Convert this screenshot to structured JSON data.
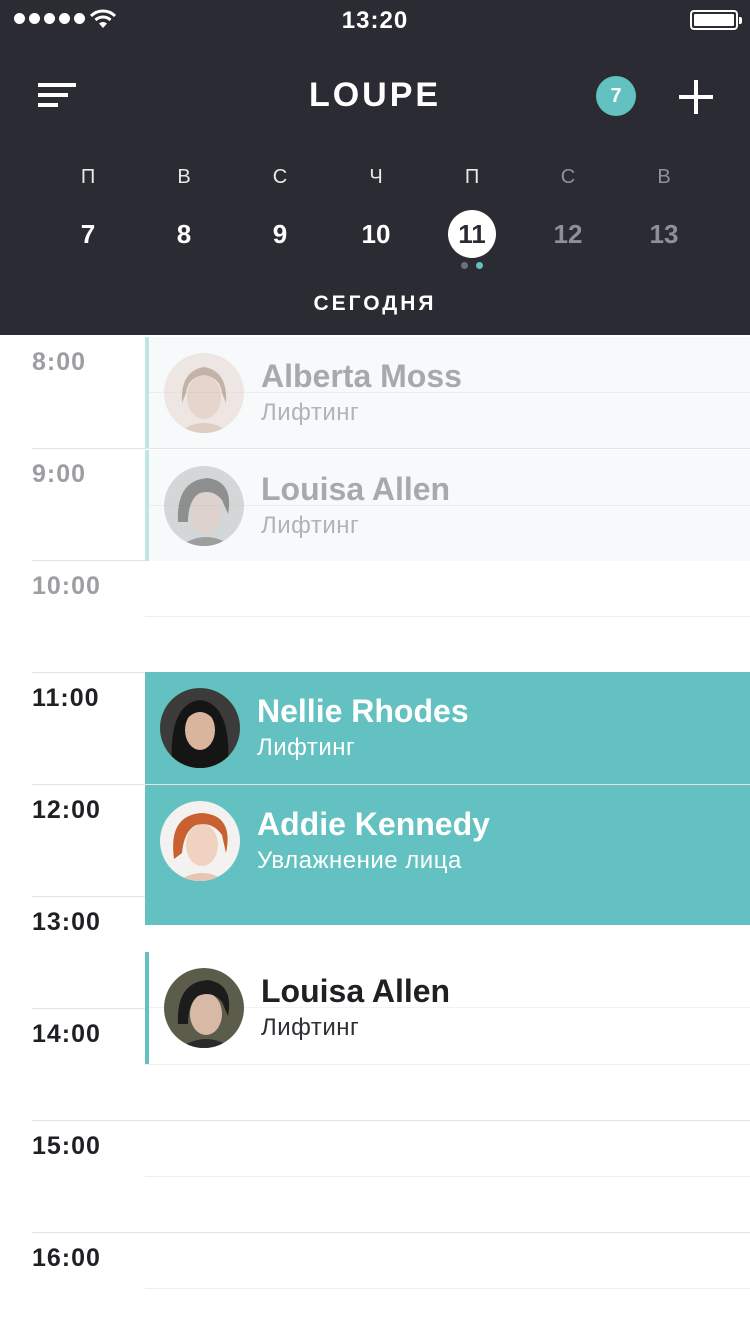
{
  "status_bar": {
    "time": "13:20"
  },
  "nav": {
    "title": "LOUPE",
    "badge_count": "7"
  },
  "week": {
    "days": [
      {
        "dow": "П",
        "num": "7",
        "state": "past"
      },
      {
        "dow": "В",
        "num": "8",
        "state": "past"
      },
      {
        "dow": "С",
        "num": "9",
        "state": "past"
      },
      {
        "dow": "Ч",
        "num": "10",
        "state": "past"
      },
      {
        "dow": "П",
        "num": "11",
        "state": "selected"
      },
      {
        "dow": "С",
        "num": "12",
        "state": "future"
      },
      {
        "dow": "В",
        "num": "13",
        "state": "future"
      }
    ],
    "dot_colors": [
      "#6e7079",
      "#63c2c1"
    ],
    "today_label": "СЕГОДНЯ"
  },
  "schedule": {
    "hours": [
      {
        "label": "8:00",
        "state": "past"
      },
      {
        "label": "9:00",
        "state": "past"
      },
      {
        "label": "10:00",
        "state": "past"
      },
      {
        "label": "11:00",
        "state": "now"
      },
      {
        "label": "12:00",
        "state": "now"
      },
      {
        "label": "13:00",
        "state": "now"
      },
      {
        "label": "14:00",
        "state": "now"
      },
      {
        "label": "15:00",
        "state": "now"
      },
      {
        "label": "16:00",
        "state": "now"
      }
    ],
    "appointments": [
      {
        "name": "Alberta Moss",
        "service": "Лифтинг",
        "state": "past"
      },
      {
        "name": "Louisa Allen",
        "service": "Лифтинг",
        "state": "past"
      },
      {
        "name": "Nellie Rhodes",
        "service": "Лифтинг",
        "state": "active"
      },
      {
        "name": "Addie Kennedy",
        "service": "Увлажнение лица",
        "state": "active"
      },
      {
        "name": "Louisa Allen",
        "service": "Лифтинг",
        "state": "upcoming"
      }
    ]
  },
  "colors": {
    "header_bg": "#2b2c33",
    "accent": "#63c2c1",
    "past_card_bg": "#f6fafb"
  }
}
